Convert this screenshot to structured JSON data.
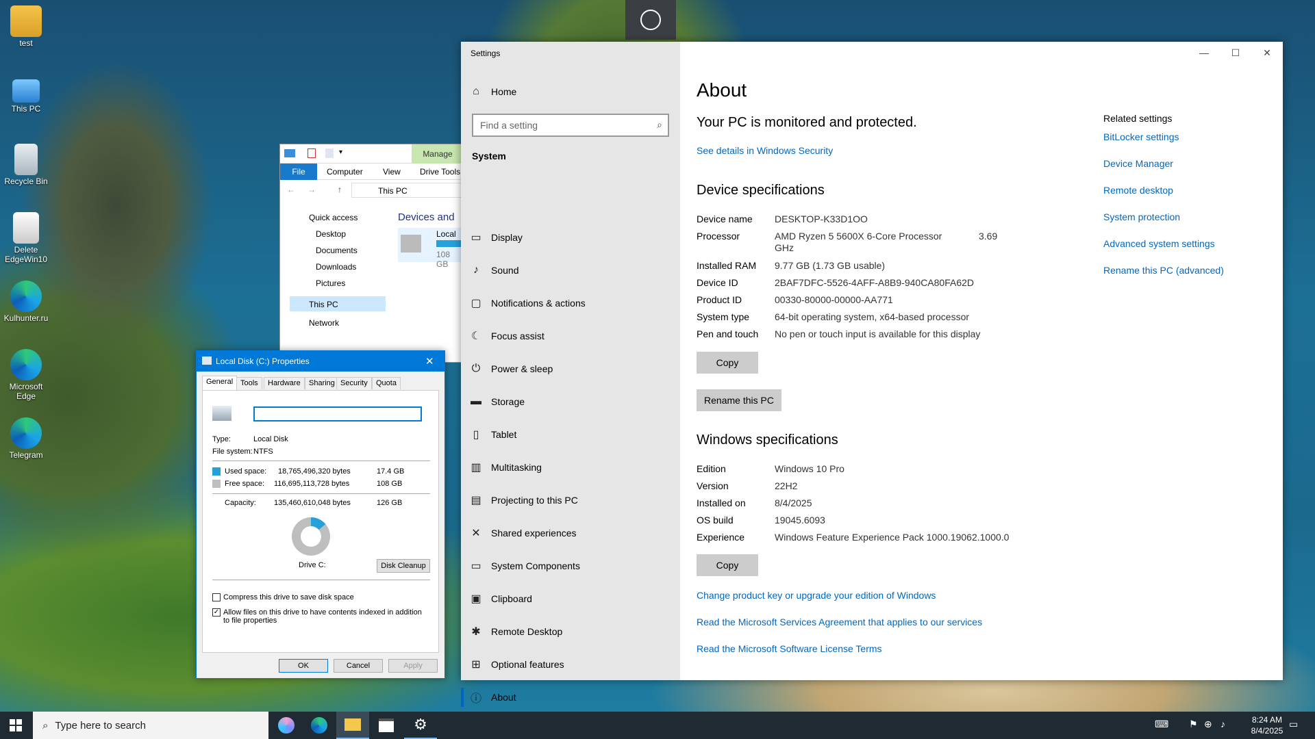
{
  "desktop": {
    "icons": [
      {
        "label": "test"
      },
      {
        "label": "This PC"
      },
      {
        "label": "Recycle Bin"
      },
      {
        "label": "Delete EdgeWin10"
      },
      {
        "label": "Kulhunter.ru"
      },
      {
        "label": "Microsoft Edge"
      },
      {
        "label": "Telegram"
      }
    ]
  },
  "taskbar": {
    "search_placeholder": "Type here to search",
    "time": "8:24 AM",
    "date": "8/4/2025"
  },
  "settings": {
    "window_title": "Settings",
    "home": "Home",
    "search_placeholder": "Find a setting",
    "section": "System",
    "nav": [
      {
        "label": "Display",
        "icon": "display-icon"
      },
      {
        "label": "Sound",
        "icon": "sound-icon"
      },
      {
        "label": "Notifications & actions",
        "icon": "notifications-icon"
      },
      {
        "label": "Focus assist",
        "icon": "focus-assist-icon"
      },
      {
        "label": "Power & sleep",
        "icon": "power-icon"
      },
      {
        "label": "Storage",
        "icon": "storage-icon"
      },
      {
        "label": "Tablet",
        "icon": "tablet-icon"
      },
      {
        "label": "Multitasking",
        "icon": "multitasking-icon"
      },
      {
        "label": "Projecting to this PC",
        "icon": "projecting-icon"
      },
      {
        "label": "Shared experiences",
        "icon": "shared-experiences-icon"
      },
      {
        "label": "System Components",
        "icon": "system-components-icon"
      },
      {
        "label": "Clipboard",
        "icon": "clipboard-icon"
      },
      {
        "label": "Remote Desktop",
        "icon": "remote-desktop-icon"
      },
      {
        "label": "Optional features",
        "icon": "optional-features-icon"
      },
      {
        "label": "About",
        "icon": "about-icon"
      }
    ],
    "about": {
      "title": "About",
      "protected": "Your PC is monitored and protected.",
      "security_link": "See details in Windows Security",
      "device_specs_title": "Device specifications",
      "device_specs": [
        {
          "k": "Device name",
          "v": "DESKTOP-K33D1OO"
        },
        {
          "k": "Processor",
          "v": "AMD Ryzen 5 5600X 6-Core Processor",
          "v2": "GHz",
          "v3": "3.69"
        },
        {
          "k": "Installed RAM",
          "v": "9.77 GB (1.73 GB usable)"
        },
        {
          "k": "Device ID",
          "v": "2BAF7DFC-5526-4AFF-A8B9-940CA80FA62D"
        },
        {
          "k": "Product ID",
          "v": "00330-80000-00000-AA771"
        },
        {
          "k": "System type",
          "v": "64-bit operating system, x64-based processor"
        },
        {
          "k": "Pen and touch",
          "v": "No pen or touch input is available for this display"
        }
      ],
      "copy": "Copy",
      "rename": "Rename this PC",
      "windows_specs_title": "Windows specifications",
      "windows_specs": [
        {
          "k": "Edition",
          "v": "Windows 10 Pro"
        },
        {
          "k": "Version",
          "v": "22H2"
        },
        {
          "k": "Installed on",
          "v": "8/4/2025"
        },
        {
          "k": "OS build",
          "v": "19045.6093"
        },
        {
          "k": "Experience",
          "v": "Windows Feature Experience Pack 1000.19062.1000.0"
        }
      ],
      "links": [
        "Change product key or upgrade your edition of Windows",
        "Read the Microsoft Services Agreement that applies to our services",
        "Read the Microsoft Software License Terms"
      ],
      "related_title": "Related settings",
      "related": [
        "BitLocker settings",
        "Device Manager",
        "Remote desktop",
        "System protection",
        "Advanced system settings",
        "Rename this PC (advanced)"
      ]
    }
  },
  "explorer": {
    "manage": "Manage",
    "ribbon_tabs": [
      "File",
      "Computer",
      "View",
      "Drive Tools"
    ],
    "path": "This PC",
    "quick_access": "Quick access",
    "pinned": [
      "Desktop",
      "Documents",
      "Downloads",
      "Pictures"
    ],
    "this_pc": "This PC",
    "network": "Network",
    "group": "Devices and",
    "drive_label": "Local D",
    "drive_free": "108 GB"
  },
  "props": {
    "title": "Local Disk (C:) Properties",
    "tabs": [
      "General",
      "Tools",
      "Hardware",
      "Sharing",
      "Security",
      "Quota"
    ],
    "name_value": "",
    "type_label": "Type:",
    "type_value": "Local Disk",
    "fs_label": "File system:",
    "fs_value": "NTFS",
    "used_label": "Used space:",
    "used_bytes": "18,765,496,320 bytes",
    "used_gb": "17.4 GB",
    "free_label": "Free space:",
    "free_bytes": "116,695,113,728 bytes",
    "free_gb": "108 GB",
    "capacity_label": "Capacity:",
    "capacity_bytes": "135,460,610,048 bytes",
    "capacity_gb": "126 GB",
    "used_fraction": 0.1385,
    "drive_label": "Drive C:",
    "disk_cleanup": "Disk Cleanup",
    "compress": "Compress this drive to save disk space",
    "index": "Allow files on this drive to have contents indexed in addition to file properties",
    "ok": "OK",
    "cancel": "Cancel",
    "apply": "Apply",
    "colors": {
      "used": "#26a0da",
      "free": "#bebebe"
    }
  }
}
